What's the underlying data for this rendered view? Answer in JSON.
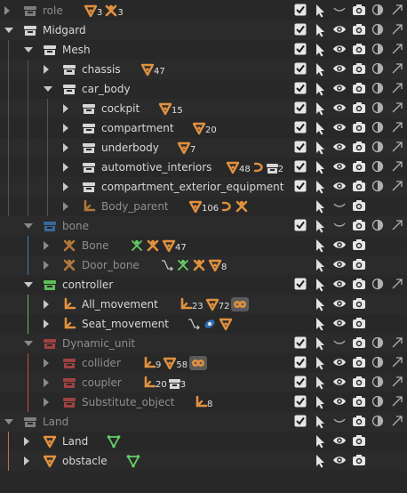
{
  "colors": {
    "accent_orange": "#e0913f",
    "link_green": "#66cc66",
    "collection_white": "#d6d6d6",
    "collection_blue": "#3c7fbf",
    "collection_green": "#5fbe5a",
    "collection_red": "#c84a4a",
    "collection_gray": "#9a9a9a"
  },
  "rows": [
    {
      "id": "role",
      "label": "role",
      "depth": 0,
      "kind": "collection",
      "color": "gray",
      "expand": "closed",
      "dim": true,
      "extras": [
        {
          "icon": "mesh-tri-icon",
          "count": "3"
        },
        {
          "icon": "armature-icon",
          "count": "3"
        }
      ],
      "controls": {
        "check": true,
        "select": true,
        "eye": false,
        "camera": true,
        "holdout": true,
        "indirect": true
      }
    },
    {
      "id": "midgard",
      "label": "Midgard",
      "depth": 0,
      "kind": "collection",
      "color": "white",
      "expand": "open",
      "dim": false,
      "extras": [],
      "controls": {
        "check": true,
        "select": true,
        "eye": true,
        "camera": true,
        "holdout": true,
        "indirect": true
      }
    },
    {
      "id": "mesh",
      "label": "Mesh",
      "depth": 1,
      "kind": "collection",
      "color": "white",
      "expand": "open",
      "dim": false,
      "extras": [],
      "controls": {
        "check": true,
        "select": true,
        "eye": true,
        "camera": true,
        "holdout": true,
        "indirect": true
      }
    },
    {
      "id": "chassis",
      "label": "chassis",
      "depth": 2,
      "kind": "collection",
      "color": "white",
      "expand": "closed",
      "dim": false,
      "extras": [
        {
          "icon": "mesh-tri-icon",
          "count": "47"
        }
      ],
      "controls": {
        "check": true,
        "select": true,
        "eye": true,
        "camera": true,
        "holdout": true,
        "indirect": true
      }
    },
    {
      "id": "car_body",
      "label": "car_body",
      "depth": 2,
      "kind": "collection",
      "color": "white",
      "expand": "open",
      "dim": false,
      "extras": [],
      "controls": {
        "check": true,
        "select": true,
        "eye": true,
        "camera": true,
        "holdout": true,
        "indirect": true
      }
    },
    {
      "id": "cockpit",
      "label": "cockpit",
      "depth": 3,
      "kind": "collection",
      "color": "white",
      "expand": "closed",
      "dim": false,
      "extras": [
        {
          "icon": "mesh-tri-icon",
          "count": "15"
        }
      ],
      "controls": {
        "check": true,
        "select": true,
        "eye": true,
        "camera": true,
        "holdout": true,
        "indirect": true
      }
    },
    {
      "id": "compartment",
      "label": "compartment",
      "depth": 3,
      "kind": "collection",
      "color": "white",
      "expand": "closed",
      "dim": false,
      "extras": [
        {
          "icon": "mesh-tri-icon",
          "count": "20"
        }
      ],
      "controls": {
        "check": true,
        "select": true,
        "eye": true,
        "camera": true,
        "holdout": true,
        "indirect": true
      }
    },
    {
      "id": "underbody",
      "label": "underbody",
      "depth": 3,
      "kind": "collection",
      "color": "white",
      "expand": "closed",
      "dim": false,
      "extras": [
        {
          "icon": "mesh-tri-icon",
          "count": "7"
        }
      ],
      "controls": {
        "check": true,
        "select": true,
        "eye": true,
        "camera": true,
        "holdout": true,
        "indirect": true
      }
    },
    {
      "id": "automotive_interiors",
      "label": "automotive_interiors",
      "depth": 3,
      "kind": "collection",
      "color": "white",
      "expand": "closed",
      "dim": false,
      "extras": [
        {
          "icon": "mesh-tri-icon",
          "count": "48"
        },
        {
          "icon": "curve-icon",
          "count": ""
        },
        {
          "icon": "collection-white-icon",
          "count": "2"
        }
      ],
      "controls": {
        "check": true,
        "select": true,
        "eye": true,
        "camera": true,
        "holdout": true,
        "indirect": true
      }
    },
    {
      "id": "compartment_exterior_equipment",
      "label": "compartment_exterior_equipment",
      "depth": 3,
      "kind": "collection",
      "color": "white",
      "expand": "closed",
      "dim": false,
      "extras": [],
      "controls": {
        "check": true,
        "select": true,
        "eye": true,
        "camera": true,
        "holdout": true,
        "indirect": true
      }
    },
    {
      "id": "body_parent",
      "label": "Body_parent",
      "depth": 3,
      "kind": "empty",
      "color": "orange",
      "expand": "closed",
      "dim": true,
      "extras": [
        {
          "icon": "mesh-tri-icon",
          "count": "106"
        },
        {
          "icon": "curve-icon",
          "count": ""
        },
        {
          "icon": "armature-icon",
          "count": ""
        }
      ],
      "controls": {
        "check": false,
        "select": true,
        "eye": false,
        "camera": true,
        "holdout": false,
        "indirect": false
      }
    },
    {
      "id": "bone",
      "label": "bone",
      "depth": 1,
      "kind": "collection",
      "color": "blue",
      "expand": "open",
      "dim": true,
      "extras": [],
      "controls": {
        "check": true,
        "select": true,
        "eye": false,
        "camera": true,
        "holdout": true,
        "indirect": true
      }
    },
    {
      "id": "bone_obj",
      "label": "Bone",
      "depth": 2,
      "kind": "armature",
      "color": "orange",
      "expand": "closed",
      "dim": true,
      "extras": [
        {
          "icon": "pose-green-icon",
          "count": ""
        },
        {
          "icon": "armature-icon",
          "count": ""
        },
        {
          "icon": "mesh-tri-icon",
          "count": "47"
        }
      ],
      "controls": {
        "check": false,
        "select": true,
        "eye": true,
        "camera": true,
        "holdout": false,
        "indirect": false
      }
    },
    {
      "id": "door_bone",
      "label": "Door_bone",
      "depth": 2,
      "kind": "armature",
      "color": "orange",
      "expand": "closed",
      "dim": true,
      "extras": [
        {
          "icon": "constraint-icon",
          "count": ""
        },
        {
          "icon": "pose-green-icon",
          "count": ""
        },
        {
          "icon": "armature-icon",
          "count": ""
        },
        {
          "icon": "mesh-tri-icon",
          "count": "8"
        }
      ],
      "controls": {
        "check": false,
        "select": true,
        "eye": true,
        "camera": true,
        "holdout": false,
        "indirect": false
      }
    },
    {
      "id": "controller",
      "label": "controller",
      "depth": 1,
      "kind": "collection",
      "color": "green",
      "expand": "open",
      "dim": false,
      "extras": [],
      "controls": {
        "check": true,
        "select": true,
        "eye": true,
        "camera": true,
        "holdout": true,
        "indirect": true
      }
    },
    {
      "id": "all_movement",
      "label": "All_movement",
      "depth": 2,
      "kind": "empty",
      "color": "orange",
      "expand": "closed",
      "dim": false,
      "extras": [
        {
          "icon": "empty-icon",
          "count": "23"
        },
        {
          "icon": "mesh-tri-icon",
          "count": "72"
        },
        {
          "icon": "film-icon",
          "count": ""
        }
      ],
      "controls": {
        "check": false,
        "select": true,
        "eye": true,
        "camera": true,
        "holdout": false,
        "indirect": false
      }
    },
    {
      "id": "seat_movement",
      "label": "Seat_movement",
      "depth": 2,
      "kind": "empty",
      "color": "orange",
      "expand": "closed",
      "dim": false,
      "extras": [
        {
          "icon": "constraint-icon",
          "count": ""
        },
        {
          "icon": "driver-icon",
          "count": ""
        },
        {
          "icon": "mesh-tri-icon",
          "count": ""
        }
      ],
      "controls": {
        "check": false,
        "select": true,
        "eye": true,
        "camera": true,
        "holdout": false,
        "indirect": false
      }
    },
    {
      "id": "dynamic_unit",
      "label": "Dynamic_unit",
      "depth": 1,
      "kind": "collection",
      "color": "red",
      "expand": "open",
      "dim": true,
      "extras": [],
      "controls": {
        "check": true,
        "select": true,
        "eye": false,
        "camera": true,
        "holdout": true,
        "indirect": true
      }
    },
    {
      "id": "collider",
      "label": "collider",
      "depth": 2,
      "kind": "collection",
      "color": "red",
      "expand": "closed",
      "dim": true,
      "extras": [
        {
          "icon": "empty-icon",
          "count": "9"
        },
        {
          "icon": "mesh-tri-icon",
          "count": "58"
        },
        {
          "icon": "film-icon",
          "count": ""
        }
      ],
      "controls": {
        "check": true,
        "select": true,
        "eye": true,
        "camera": true,
        "holdout": true,
        "indirect": true
      }
    },
    {
      "id": "coupler",
      "label": "coupler",
      "depth": 2,
      "kind": "collection",
      "color": "red",
      "expand": "closed",
      "dim": true,
      "extras": [
        {
          "icon": "empty-icon",
          "count": "20"
        },
        {
          "icon": "collection-white-icon",
          "count": "3"
        }
      ],
      "controls": {
        "check": true,
        "select": true,
        "eye": true,
        "camera": true,
        "holdout": true,
        "indirect": true
      }
    },
    {
      "id": "substitute_object",
      "label": "Substitute_object",
      "depth": 2,
      "kind": "collection",
      "color": "red",
      "expand": "closed",
      "dim": true,
      "extras": [
        {
          "icon": "empty-icon",
          "count": "8"
        }
      ],
      "controls": {
        "check": true,
        "select": true,
        "eye": true,
        "camera": true,
        "holdout": true,
        "indirect": true
      }
    },
    {
      "id": "land",
      "label": "Land",
      "depth": 0,
      "kind": "collection",
      "color": "gray",
      "expand": "open",
      "dim": true,
      "extras": [],
      "controls": {
        "check": true,
        "select": true,
        "eye": false,
        "camera": true,
        "holdout": true,
        "indirect": true
      }
    },
    {
      "id": "land_obj",
      "label": "Land",
      "depth": 1,
      "kind": "mesh",
      "color": "orange",
      "expand": "closed",
      "dim": false,
      "extras": [
        {
          "icon": "mesh-green-icon",
          "count": ""
        }
      ],
      "controls": {
        "check": false,
        "select": true,
        "eye": true,
        "camera": true,
        "holdout": false,
        "indirect": false
      }
    },
    {
      "id": "obstacle",
      "label": "obstacle",
      "depth": 1,
      "kind": "mesh",
      "color": "orange",
      "expand": "closed",
      "dim": false,
      "extras": [
        {
          "icon": "mesh-green-icon",
          "count": ""
        }
      ],
      "controls": {
        "check": false,
        "select": true,
        "eye": true,
        "camera": true,
        "holdout": false,
        "indirect": false
      }
    }
  ]
}
